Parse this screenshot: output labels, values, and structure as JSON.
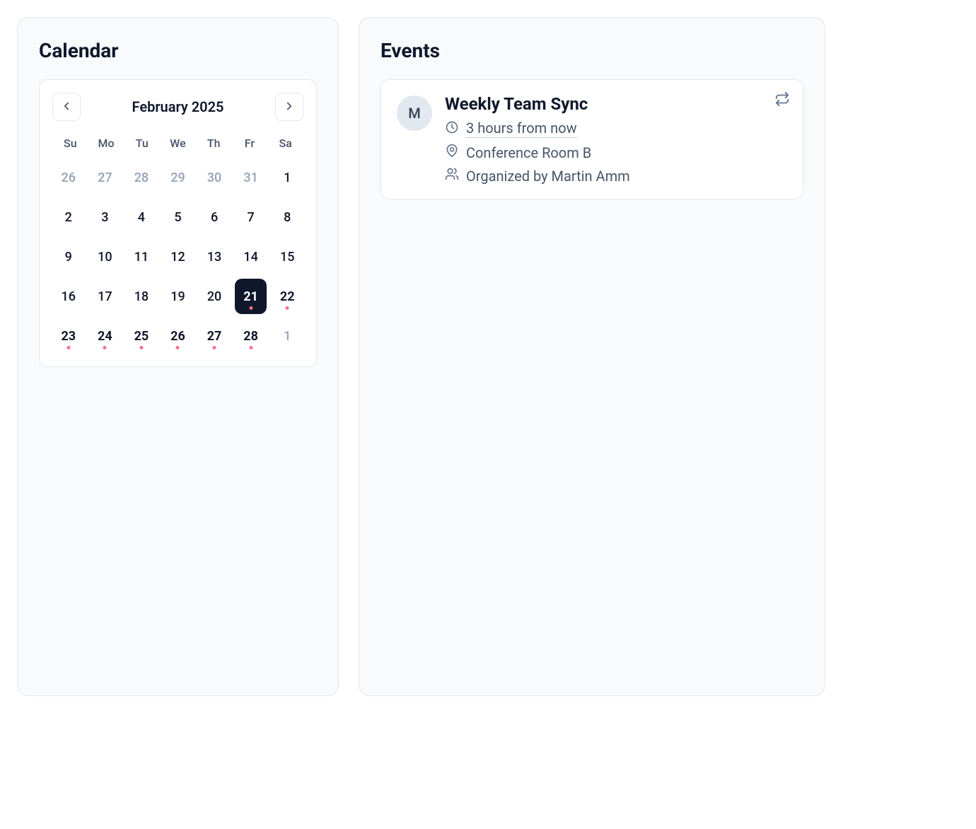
{
  "calendar": {
    "title": "Calendar",
    "month_label": "February 2025",
    "weekdays": [
      "Su",
      "Mo",
      "Tu",
      "We",
      "Th",
      "Fr",
      "Sa"
    ],
    "days": [
      {
        "d": "26",
        "outside": true,
        "selected": false,
        "has_event": false
      },
      {
        "d": "27",
        "outside": true,
        "selected": false,
        "has_event": false
      },
      {
        "d": "28",
        "outside": true,
        "selected": false,
        "has_event": false
      },
      {
        "d": "29",
        "outside": true,
        "selected": false,
        "has_event": false
      },
      {
        "d": "30",
        "outside": true,
        "selected": false,
        "has_event": false
      },
      {
        "d": "31",
        "outside": true,
        "selected": false,
        "has_event": false
      },
      {
        "d": "1",
        "outside": false,
        "selected": false,
        "has_event": false
      },
      {
        "d": "2",
        "outside": false,
        "selected": false,
        "has_event": false
      },
      {
        "d": "3",
        "outside": false,
        "selected": false,
        "has_event": false
      },
      {
        "d": "4",
        "outside": false,
        "selected": false,
        "has_event": false
      },
      {
        "d": "5",
        "outside": false,
        "selected": false,
        "has_event": false
      },
      {
        "d": "6",
        "outside": false,
        "selected": false,
        "has_event": false
      },
      {
        "d": "7",
        "outside": false,
        "selected": false,
        "has_event": false
      },
      {
        "d": "8",
        "outside": false,
        "selected": false,
        "has_event": false
      },
      {
        "d": "9",
        "outside": false,
        "selected": false,
        "has_event": false
      },
      {
        "d": "10",
        "outside": false,
        "selected": false,
        "has_event": false
      },
      {
        "d": "11",
        "outside": false,
        "selected": false,
        "has_event": false
      },
      {
        "d": "12",
        "outside": false,
        "selected": false,
        "has_event": false
      },
      {
        "d": "13",
        "outside": false,
        "selected": false,
        "has_event": false
      },
      {
        "d": "14",
        "outside": false,
        "selected": false,
        "has_event": false
      },
      {
        "d": "15",
        "outside": false,
        "selected": false,
        "has_event": false
      },
      {
        "d": "16",
        "outside": false,
        "selected": false,
        "has_event": false
      },
      {
        "d": "17",
        "outside": false,
        "selected": false,
        "has_event": false
      },
      {
        "d": "18",
        "outside": false,
        "selected": false,
        "has_event": false
      },
      {
        "d": "19",
        "outside": false,
        "selected": false,
        "has_event": false
      },
      {
        "d": "20",
        "outside": false,
        "selected": false,
        "has_event": false
      },
      {
        "d": "21",
        "outside": false,
        "selected": true,
        "has_event": true
      },
      {
        "d": "22",
        "outside": false,
        "selected": false,
        "has_event": true
      },
      {
        "d": "23",
        "outside": false,
        "selected": false,
        "has_event": true
      },
      {
        "d": "24",
        "outside": false,
        "selected": false,
        "has_event": true
      },
      {
        "d": "25",
        "outside": false,
        "selected": false,
        "has_event": true
      },
      {
        "d": "26",
        "outside": false,
        "selected": false,
        "has_event": true
      },
      {
        "d": "27",
        "outside": false,
        "selected": false,
        "has_event": true
      },
      {
        "d": "28",
        "outside": false,
        "selected": false,
        "has_event": true
      },
      {
        "d": "1",
        "outside": true,
        "selected": false,
        "has_event": false
      }
    ]
  },
  "events": {
    "title": "Events",
    "items": [
      {
        "avatar_initial": "M",
        "title": "Weekly Team Sync",
        "time": "3 hours from now",
        "location": "Conference Room B",
        "organizer": "Organized by Martin Amm",
        "recurring": true
      }
    ]
  }
}
